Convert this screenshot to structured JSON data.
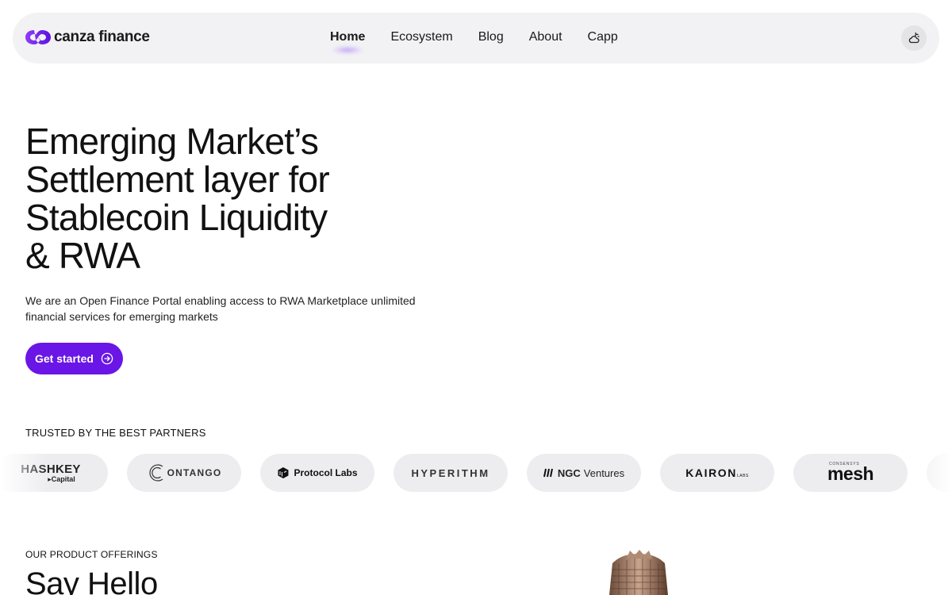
{
  "brand": {
    "name": "canza finance",
    "accent": "#6a16e6"
  },
  "nav": {
    "links": [
      {
        "label": "Home",
        "active": true
      },
      {
        "label": "Ecosystem",
        "active": false
      },
      {
        "label": "Blog",
        "active": false
      },
      {
        "label": "About",
        "active": false
      },
      {
        "label": "Capp",
        "active": false
      }
    ],
    "theme_toggle_icon": "theme-toggle-icon"
  },
  "hero": {
    "title_lines": [
      "Emerging Market’s",
      "Settlement layer for",
      "Stablecoin Liquidity",
      "& RWA"
    ],
    "subtitle": "We are an Open Finance Portal enabling access to RWA Marketplace unlimited financial services for emerging markets",
    "cta_label": "Get started",
    "cta_icon": "arrow-right-circle-icon"
  },
  "partners": {
    "heading": "TRUSTED BY THE BEST PARTNERS",
    "logos": {
      "hashkey": {
        "main": "HASHKEY",
        "sub": "Capital"
      },
      "contango": "ONTANGO",
      "protocol_labs": "Protocol Labs",
      "hyperithm": "HYPERITHM",
      "ngc": {
        "bold": "NGC",
        "rest": "Ventures"
      },
      "kairon": {
        "main": "KAIRON",
        "suffix": "LABS"
      },
      "mesh": {
        "tag": "CONSENSYS",
        "main": "mesh"
      }
    }
  },
  "offerings": {
    "heading": "OUR PRODUCT OFFERINGS",
    "title": "Say Hello"
  }
}
